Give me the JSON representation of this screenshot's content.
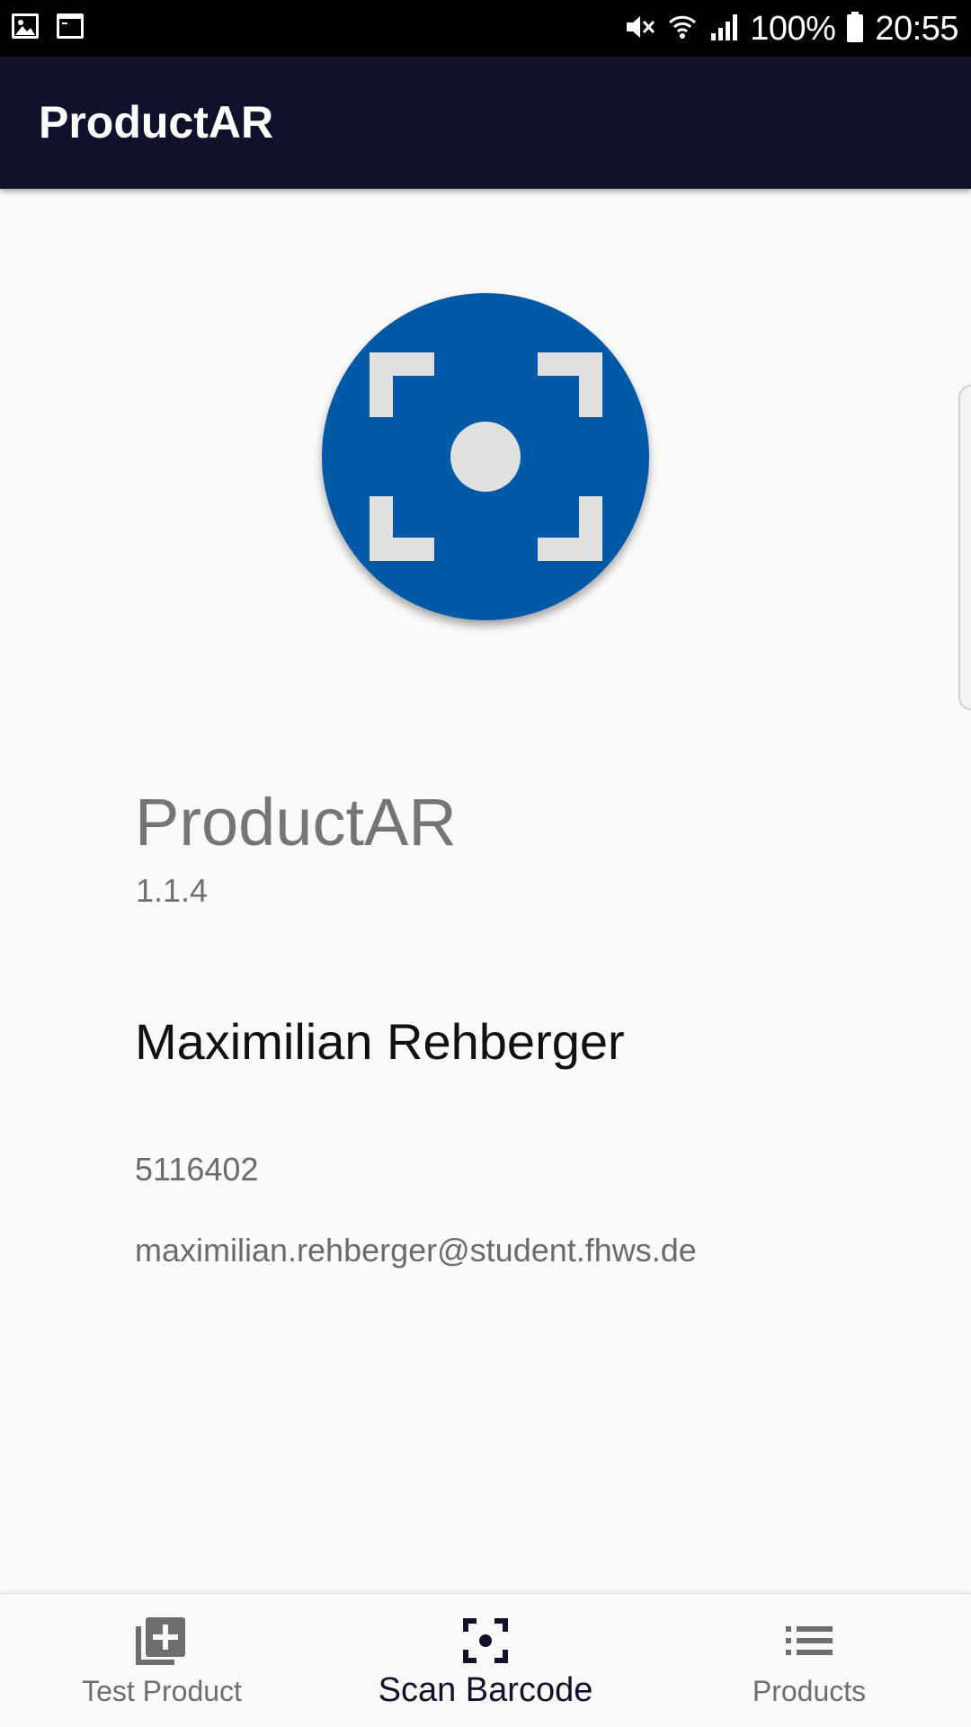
{
  "status_bar": {
    "battery": "100%",
    "time": "20:55",
    "icons": [
      "gallery-notification-icon",
      "terminal-notification-icon",
      "mute-icon",
      "wifi-icon",
      "signal-icon",
      "battery-icon"
    ]
  },
  "app_bar": {
    "title": "ProductAR",
    "background": "#10112b"
  },
  "about": {
    "logo_icon": "scan-barcode-logo-icon",
    "logo_color": "#0059a7",
    "app_name": "ProductAR",
    "version": "1.1.4",
    "author": "Maximilian Rehberger",
    "student_id": "5116402",
    "email": "maximilian.rehberger@student.fhws.de"
  },
  "bottom_nav": {
    "active_index": 1,
    "items": [
      {
        "label": "Test Product",
        "icon": "add-library-icon"
      },
      {
        "label": "Scan Barcode",
        "icon": "center-focus-icon"
      },
      {
        "label": "Products",
        "icon": "list-icon"
      }
    ]
  }
}
